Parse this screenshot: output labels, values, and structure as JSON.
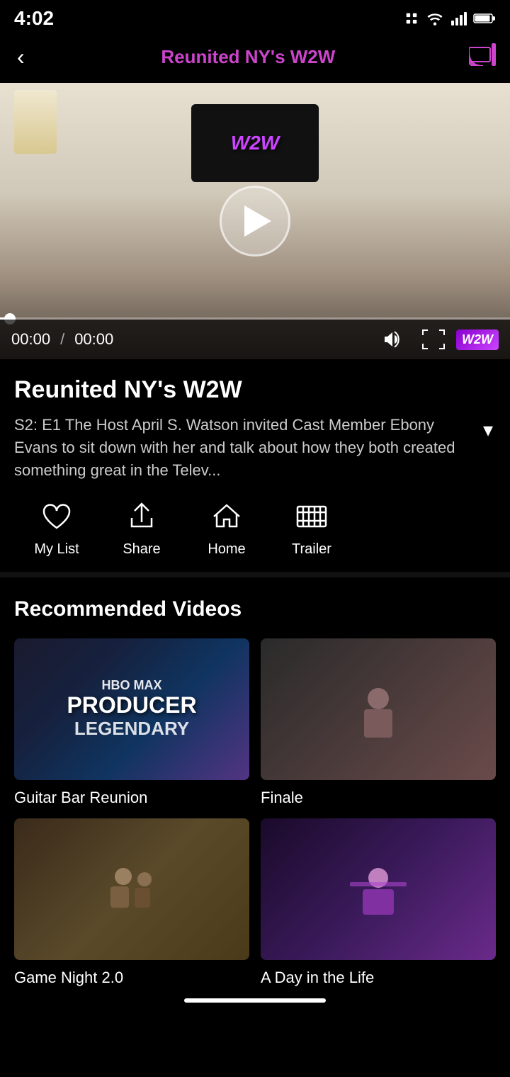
{
  "statusBar": {
    "time": "4:02",
    "icons": [
      "notification-icon",
      "wifi-icon",
      "signal-icon",
      "battery-icon"
    ]
  },
  "navbar": {
    "backLabel": "‹",
    "title": "Reunited NY's W2W",
    "castIcon": "cast-icon"
  },
  "videoPlayer": {
    "currentTime": "00:00",
    "totalTime": "00:00",
    "progressPercent": 2,
    "brandLabel": "W2W",
    "playButtonAlt": "Play video"
  },
  "showInfo": {
    "title": "Reunited NY's W2W",
    "description": "S2: E1 The Host April S. Watson invited Cast Member Ebony Evans to sit down with her and talk about how they both created something great in the Telev...",
    "expandLabel": "▾"
  },
  "actionBar": {
    "myList": {
      "label": "My List",
      "icon": "heart-icon"
    },
    "share": {
      "label": "Share",
      "icon": "share-icon"
    },
    "home": {
      "label": "Home",
      "icon": "home-icon"
    },
    "trailer": {
      "label": "Trailer",
      "icon": "film-icon"
    }
  },
  "recommendedSection": {
    "title": "Recommended Videos",
    "videos": [
      {
        "id": "guitar-bar-reunion",
        "title": "Guitar Bar Reunion",
        "thumbType": "hbo-style"
      },
      {
        "id": "finale",
        "title": "Finale",
        "thumbType": "party"
      },
      {
        "id": "game-night",
        "title": "Game Night 2.0",
        "thumbType": "indoor"
      },
      {
        "id": "day-in-life",
        "title": "A Day in the Life",
        "thumbType": "club"
      }
    ]
  }
}
